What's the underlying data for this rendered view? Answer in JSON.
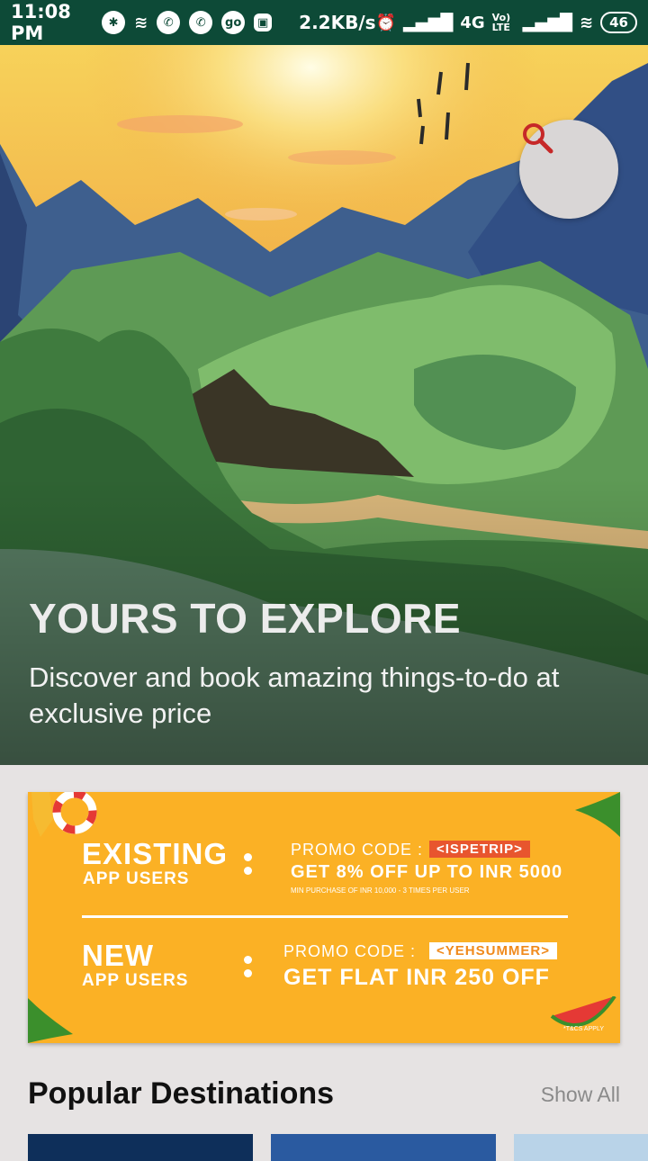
{
  "status_bar": {
    "time": "11:08 PM",
    "speed": "2.2KB/s",
    "network": "4G",
    "volte": "Vo) LTE",
    "battery": "46"
  },
  "hero": {
    "title": "YOURS TO EXPLORE",
    "subtitle": "Discover and book amazing things-to-do at exclusive price"
  },
  "search": {
    "icon": "search-icon",
    "color": "#c62828"
  },
  "promo": {
    "existing_title": "EXISTING",
    "existing_sub": "APP USERS",
    "existing_label": "PROMO CODE :",
    "existing_code": "<ISPETRIP>",
    "existing_offer": "GET 8% OFF UP TO INR 5000",
    "existing_min": "MIN PURCHASE OF INR 10,000 - 3 TIMES PER USER",
    "new_title": "NEW",
    "new_sub": "APP USERS",
    "new_label": "PROMO CODE :",
    "new_code": "<YEHSUMMER>",
    "new_offer": "GET FLAT INR 250 OFF",
    "tnc": "*T&CS APPLY"
  },
  "popular": {
    "title": "Popular Destinations",
    "show_all": "Show All"
  }
}
